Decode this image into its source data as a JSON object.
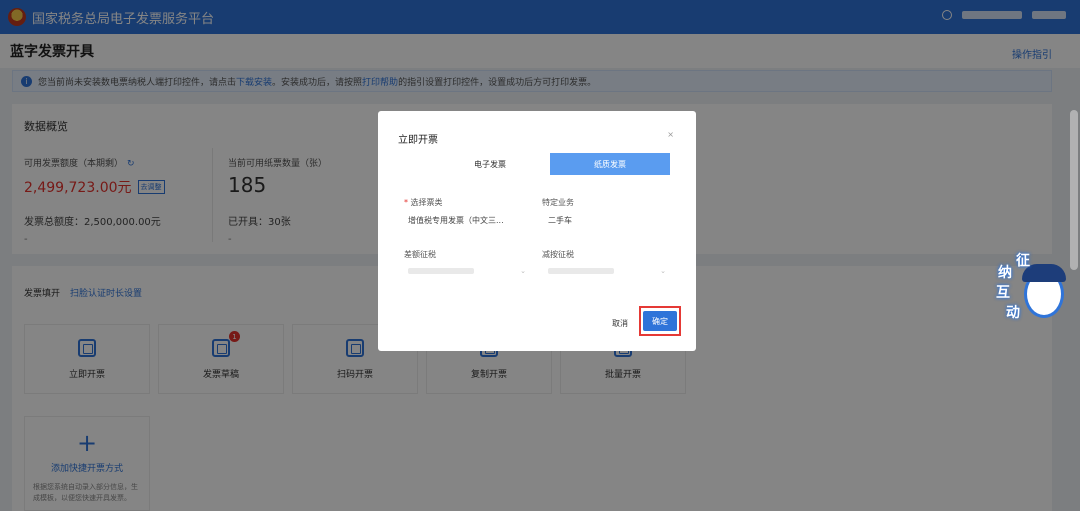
{
  "app": {
    "title": "国家税务总局电子发票服务平台"
  },
  "header": {
    "page_title": "蓝字发票开具",
    "guide_link": "操作指引"
  },
  "notice": {
    "text_before": "您当前尚未安装数电票纳税人端打印控件，请点击",
    "link_download": "下载安装",
    "text_middle": "。安装成功后，请按照",
    "link_help": "打印帮助",
    "text_after": "的指引设置打印控件，设置成功后方可打印发票。"
  },
  "overview": {
    "title": "数据概览",
    "quota_label": "可用发票额度（本期剩）",
    "quota_value": "2,499,723.00元",
    "quota_badge": "去调整",
    "paper_label": "当前可用纸票数量（张）",
    "paper_count": "185",
    "total_quota": "发票总额度：2,500,000.00元",
    "issued": "已开具：30张",
    "dash1": "-",
    "dash2": "-"
  },
  "fill": {
    "title": "发票填开",
    "link": "扫脸认证时长设置",
    "tiles": [
      {
        "label": "立即开票"
      },
      {
        "label": "发票草稿",
        "badge": "1"
      },
      {
        "label": "扫码开票"
      },
      {
        "label": "复制开票"
      },
      {
        "label": "批量开票"
      }
    ],
    "add_label": "添加快捷开票方式",
    "add_desc": "根据您系统自动录入部分信息，生成模板，以便您快速开具发票。"
  },
  "mascot": {
    "w1": "征",
    "w2": "纳",
    "w3": "互",
    "w4": "动"
  },
  "dialog": {
    "title": "立即开票",
    "close": "×",
    "tab_electronic": "电子发票",
    "tab_paper": "纸质发票",
    "invoice_type_label": "选择票类",
    "invoice_type_value": "增值税专用发票（中文三...",
    "special_label": "特定业务",
    "special_value": "二手车",
    "diff_label": "差额征税",
    "reduce_label": "减按征税",
    "cancel": "取消",
    "confirm": "确定"
  }
}
